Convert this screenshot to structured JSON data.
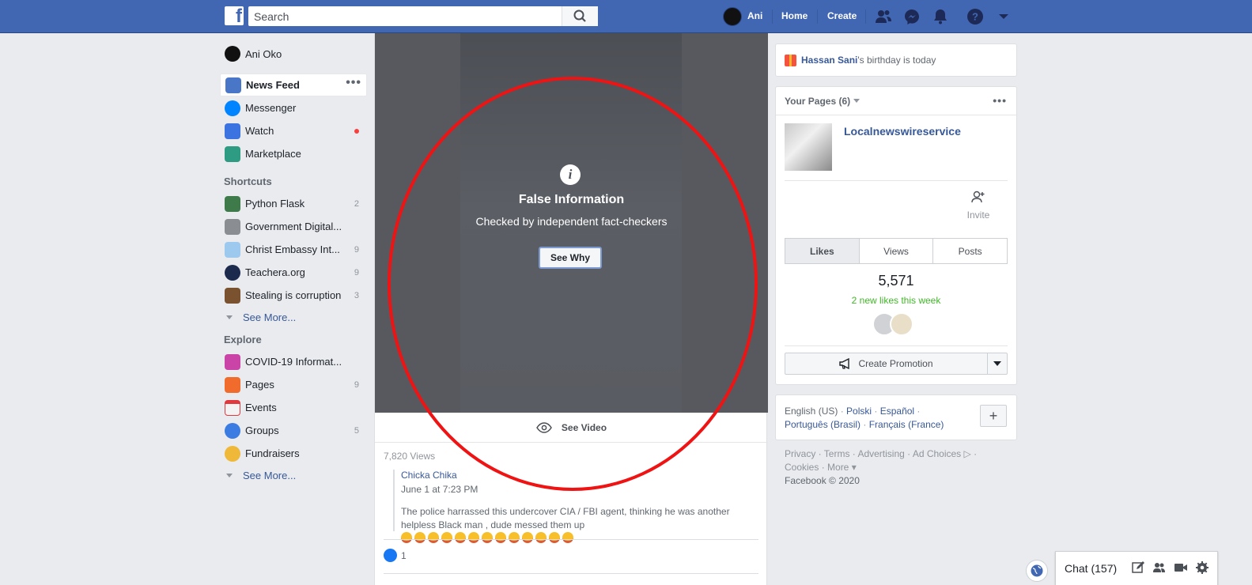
{
  "topbar": {
    "logo": "f",
    "search_placeholder": "Search",
    "user_name": "Ani",
    "home": "Home",
    "create": "Create",
    "icons": [
      "friends-icon",
      "messenger-icon",
      "notifications-icon",
      "help-icon",
      "account-menu-icon"
    ]
  },
  "leftnav": {
    "profile_name": "Ani Oko",
    "main": [
      {
        "label": "News Feed",
        "icon": "newsfeed-icon"
      },
      {
        "label": "Messenger",
        "icon": "messenger-icon"
      },
      {
        "label": "Watch",
        "icon": "watch-icon"
      },
      {
        "label": "Marketplace",
        "icon": "marketplace-icon"
      }
    ],
    "shortcuts_title": "Shortcuts",
    "shortcuts": [
      {
        "label": "Python Flask",
        "count": "2"
      },
      {
        "label": "Government Digital...",
        "count": ""
      },
      {
        "label": "Christ Embassy Int...",
        "count": "9"
      },
      {
        "label": "Teachera.org",
        "count": "9"
      },
      {
        "label": "Stealing is corruption",
        "count": "3"
      }
    ],
    "see_more": "See More...",
    "explore_title": "Explore",
    "explore": [
      {
        "label": "COVID-19 Informat...",
        "count": ""
      },
      {
        "label": "Pages",
        "count": "9"
      },
      {
        "label": "Events",
        "count": ""
      },
      {
        "label": "Groups",
        "count": "5"
      },
      {
        "label": "Fundraisers",
        "count": ""
      }
    ]
  },
  "post": {
    "warning_title": "False Information",
    "warning_sub": "Checked by independent fact-checkers",
    "see_why": "See Why",
    "see_video": "See Video",
    "views": "7,820 Views",
    "quote_author": "Chicka Chika",
    "quote_date": "June 1 at 7:23 PM",
    "quote_text": "The police harrassed this undercover CIA / FBI agent, thinking he was another helpless Black man , dude messed them up",
    "like_count": "1"
  },
  "right": {
    "birthday_name": "Hassan Sani",
    "birthday_text": "'s birthday is today",
    "your_pages": "Your Pages (6)",
    "page_name": "Localnewswireservice",
    "invite": "Invite",
    "tabs": [
      "Likes",
      "Views",
      "Posts"
    ],
    "like_total": "5,571",
    "new_likes": "2 new likes this week",
    "create_promotion": "Create Promotion",
    "lang_current": "English (US)",
    "lang_1": "Polski",
    "lang_2": "Español",
    "lang_3": "Português (Brasil)",
    "lang_4": "Français (France)",
    "footer_line1": "Privacy · Terms · Advertising · Ad Choices ▷ ·",
    "footer_line2": "Cookies · More ▾",
    "footer_copy": "Facebook © 2020"
  },
  "chat": {
    "label": "Chat (157)"
  },
  "colors": {
    "brand": "#4267b2",
    "link": "#385898",
    "annotation": "#ef1313"
  }
}
